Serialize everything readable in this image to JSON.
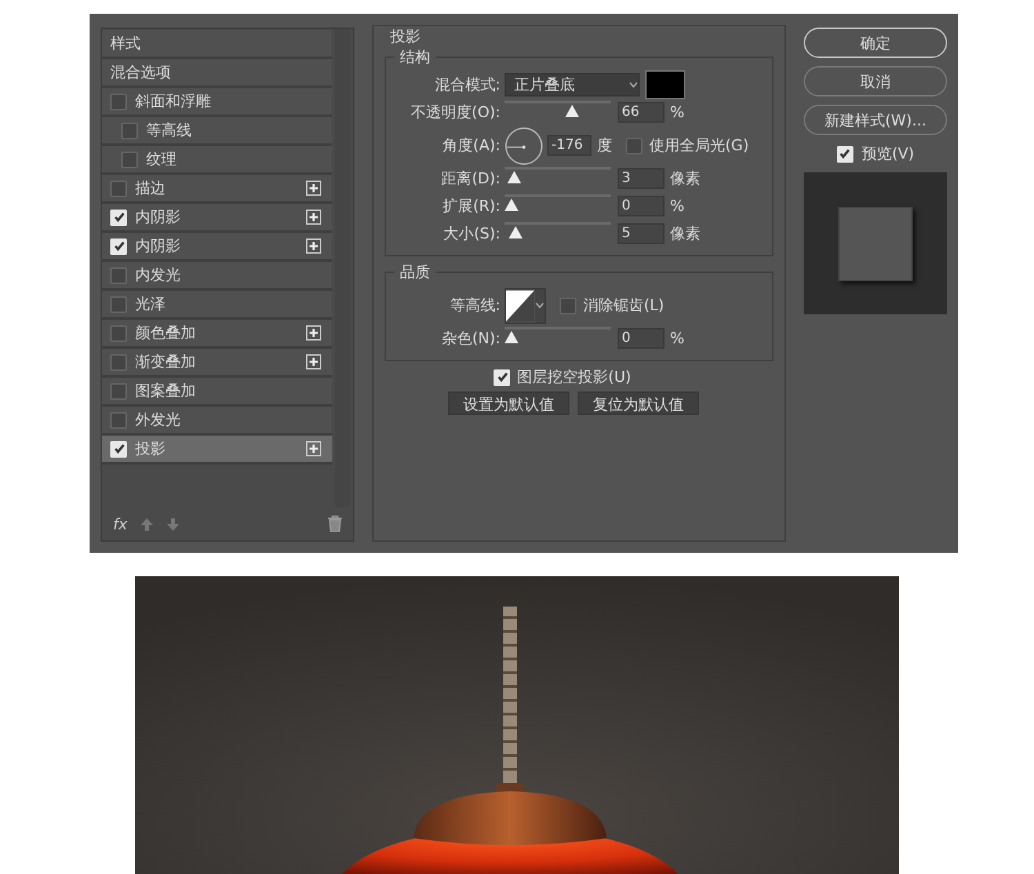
{
  "styles_panel": {
    "items": [
      {
        "label": "样式",
        "kind": "heading",
        "selected": false
      },
      {
        "label": "混合选项",
        "kind": "heading",
        "selected": false
      },
      {
        "label": "斜面和浮雕",
        "kind": "effect",
        "checked": false,
        "selected": false,
        "add_button": false,
        "children": [
          {
            "label": "等高线",
            "kind": "effect",
            "checked": false,
            "selected": false,
            "add_button": false
          },
          {
            "label": "纹理",
            "kind": "effect",
            "checked": false,
            "selected": false,
            "add_button": false
          }
        ]
      },
      {
        "label": "描边",
        "kind": "effect",
        "checked": false,
        "selected": false,
        "add_button": true
      },
      {
        "label": "内阴影",
        "kind": "effect",
        "checked": true,
        "selected": false,
        "add_button": true
      },
      {
        "label": "内阴影",
        "kind": "effect",
        "checked": true,
        "selected": false,
        "add_button": true
      },
      {
        "label": "内发光",
        "kind": "effect",
        "checked": false,
        "selected": false,
        "add_button": false
      },
      {
        "label": "光泽",
        "kind": "effect",
        "checked": false,
        "selected": false,
        "add_button": false
      },
      {
        "label": "颜色叠加",
        "kind": "effect",
        "checked": false,
        "selected": false,
        "add_button": true
      },
      {
        "label": "渐变叠加",
        "kind": "effect",
        "checked": false,
        "selected": false,
        "add_button": true
      },
      {
        "label": "图案叠加",
        "kind": "effect",
        "checked": false,
        "selected": false,
        "add_button": false
      },
      {
        "label": "外发光",
        "kind": "effect",
        "checked": false,
        "selected": false,
        "add_button": false
      },
      {
        "label": "投影",
        "kind": "effect",
        "checked": true,
        "selected": true,
        "add_button": true
      }
    ],
    "toolbar": {
      "fx": "fx"
    }
  },
  "settings": {
    "title": "投影",
    "groups": [
      {
        "title": "结构",
        "rows": [
          {
            "kind": "select",
            "label": "混合模式:",
            "value": "正片叠底",
            "color": "#000000"
          },
          {
            "kind": "slider",
            "label": "不透明度(O):",
            "value": "66",
            "unit": "%",
            "level": 0.66
          },
          {
            "kind": "angle",
            "label": "角度(A):",
            "value": "-176",
            "unit": "度",
            "option": {
              "label": "使用全局光(G)",
              "checked": false
            }
          },
          {
            "kind": "slider",
            "label": "距离(D):",
            "value": "3",
            "unit": "像素",
            "level": 0.03
          },
          {
            "kind": "slider",
            "label": "扩展(R):",
            "value": "0",
            "unit": "%",
            "level": 0
          },
          {
            "kind": "slider",
            "label": "大小(S):",
            "value": "5",
            "unit": "像素",
            "level": 0.05
          }
        ]
      },
      {
        "title": "品质",
        "rows": [
          {
            "kind": "contour",
            "label": "等高线:",
            "option": {
              "label": "消除锯齿(L)",
              "checked": false
            }
          },
          {
            "kind": "slider",
            "label": "杂色(N):",
            "value": "0",
            "unit": "%",
            "level": 0
          }
        ]
      }
    ],
    "knockout": {
      "label": "图层挖空投影(U)",
      "checked": true
    },
    "buttons": [
      "设置为默认值",
      "复位为默认值"
    ]
  },
  "actions": {
    "buttons": [
      {
        "label": "确定",
        "default": true
      },
      {
        "label": "取消",
        "default": false
      },
      {
        "label": "新建样式(W)...",
        "default": false
      }
    ],
    "preview": {
      "label": "预览(V)",
      "checked": true
    }
  }
}
